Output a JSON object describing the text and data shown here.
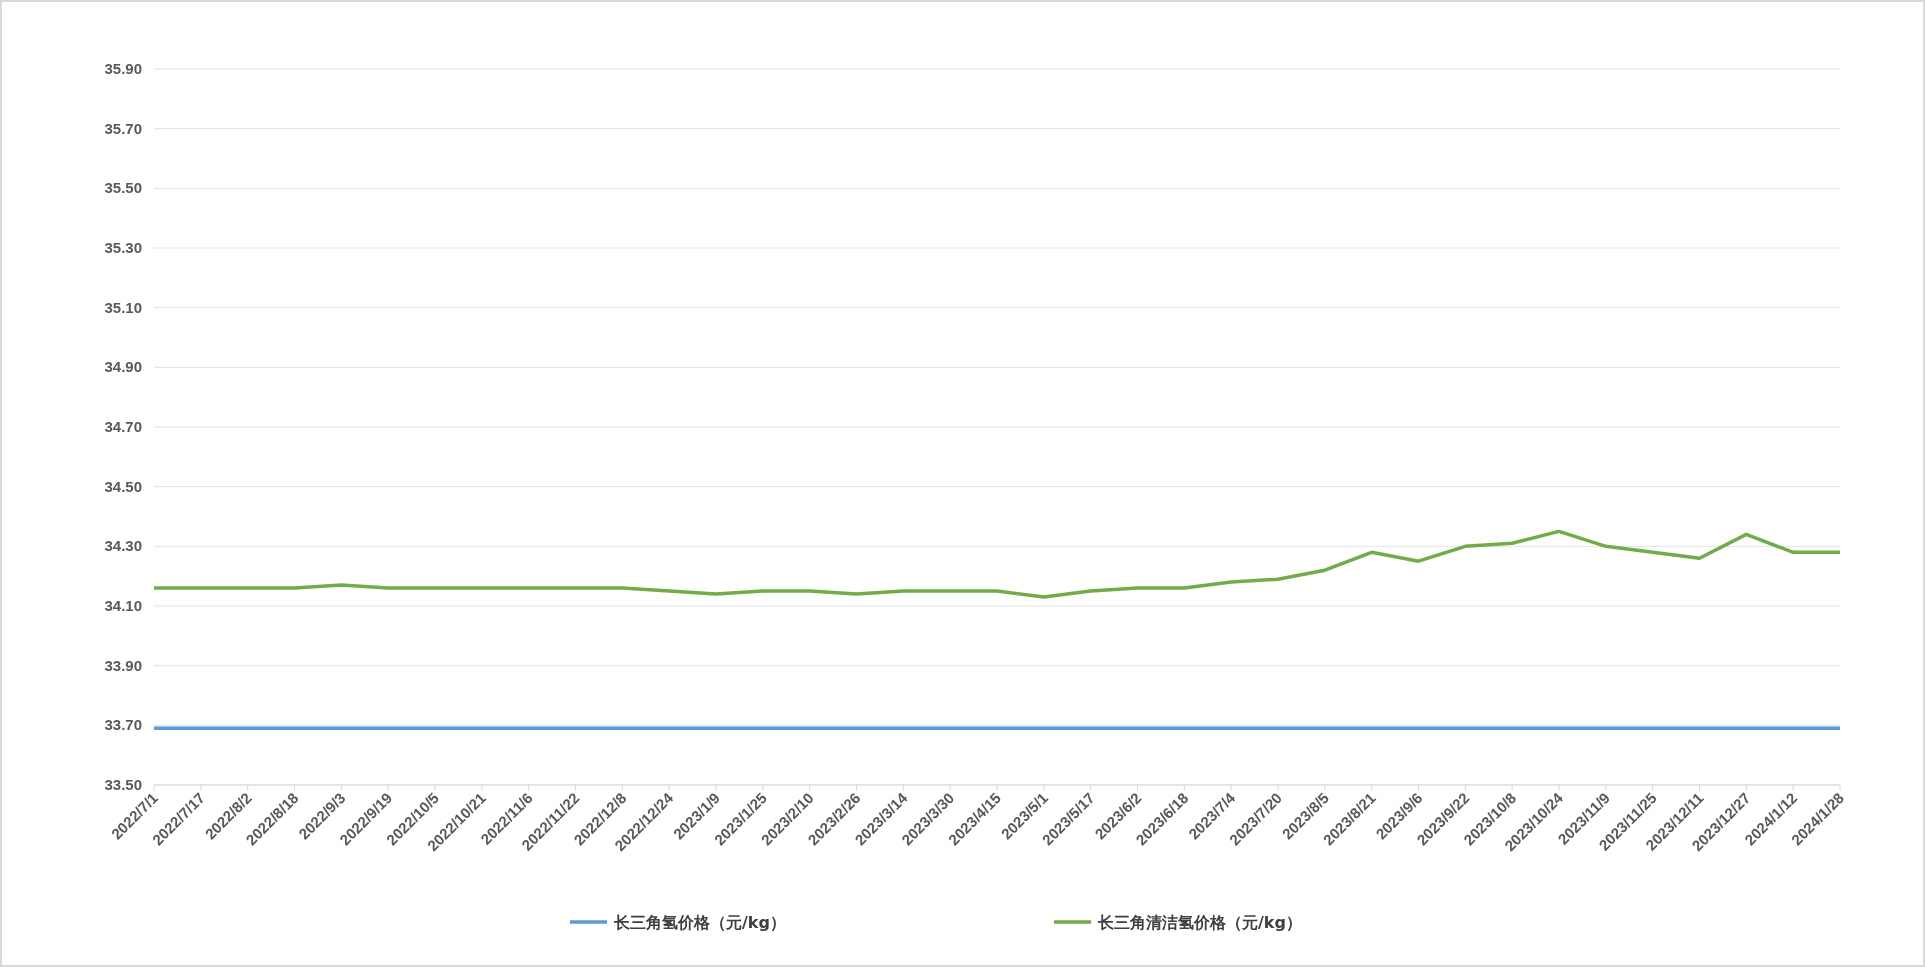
{
  "chart_data": {
    "type": "line",
    "grid": true,
    "legend": "bottom",
    "categories": [
      "2022/7/1",
      "2022/7/17",
      "2022/8/2",
      "2022/8/18",
      "2022/9/3",
      "2022/9/19",
      "2022/10/5",
      "2022/10/21",
      "2022/11/6",
      "2022/11/22",
      "2022/12/8",
      "2022/12/24",
      "2023/1/9",
      "2023/1/25",
      "2023/2/10",
      "2023/2/26",
      "2023/3/14",
      "2023/3/30",
      "2023/4/15",
      "2023/5/1",
      "2023/5/17",
      "2023/6/2",
      "2023/6/18",
      "2023/7/4",
      "2023/7/20",
      "2023/8/5",
      "2023/8/21",
      "2023/9/6",
      "2023/9/22",
      "2023/10/8",
      "2023/10/24",
      "2023/11/9",
      "2023/11/25",
      "2023/12/11",
      "2023/12/27",
      "2024/1/12",
      "2024/1/28"
    ],
    "series": [
      {
        "name": "长三角氢价格（元/kg）",
        "color": "#5b9bd5",
        "values": [
          33.69,
          33.69,
          33.69,
          33.69,
          33.69,
          33.69,
          33.69,
          33.69,
          33.69,
          33.69,
          33.69,
          33.69,
          33.69,
          33.69,
          33.69,
          33.69,
          33.69,
          33.69,
          33.69,
          33.69,
          33.69,
          33.69,
          33.69,
          33.69,
          33.69,
          33.69,
          33.69,
          33.69,
          33.69,
          33.69,
          33.69,
          33.69,
          33.69,
          33.69,
          33.69,
          33.69,
          33.69
        ]
      },
      {
        "name": "长三角清洁氢价格（元/kg）",
        "color": "#70ad47",
        "values": [
          34.16,
          34.16,
          34.16,
          34.16,
          34.17,
          34.16,
          34.16,
          34.16,
          34.16,
          34.16,
          34.16,
          34.15,
          34.14,
          34.15,
          34.15,
          34.14,
          34.15,
          34.15,
          34.15,
          34.13,
          34.15,
          34.16,
          34.16,
          34.18,
          34.19,
          34.22,
          34.28,
          34.25,
          34.3,
          34.31,
          34.35,
          34.3,
          34.28,
          34.26,
          34.34,
          34.28,
          34.28
        ]
      }
    ],
    "ylim": [
      33.5,
      35.9
    ],
    "yticks": [
      {
        "value": 33.5,
        "label": "33.50"
      },
      {
        "value": 33.7,
        "label": "33.70"
      },
      {
        "value": 33.9,
        "label": "33.90"
      },
      {
        "value": 34.1,
        "label": "34.10"
      },
      {
        "value": 34.3,
        "label": "34.30"
      },
      {
        "value": 34.5,
        "label": "34.50"
      },
      {
        "value": 34.7,
        "label": "34.70"
      },
      {
        "value": 34.9,
        "label": "34.90"
      },
      {
        "value": 35.1,
        "label": "35.10"
      },
      {
        "value": 35.3,
        "label": "35.30"
      },
      {
        "value": 35.5,
        "label": "35.50"
      },
      {
        "value": 35.7,
        "label": "35.70"
      },
      {
        "value": 35.9,
        "label": "35.90"
      }
    ]
  }
}
